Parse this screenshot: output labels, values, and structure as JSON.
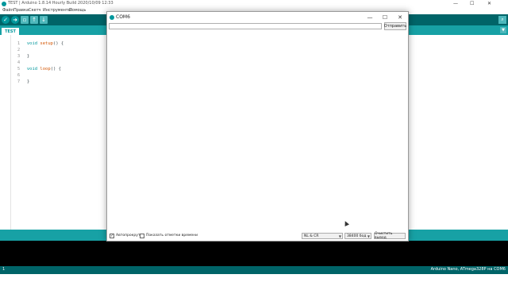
{
  "ide": {
    "title": "TEST | Arduino 1.8.14 Hourly Build 2020/10/09 12:33",
    "window_controls": {
      "minimize": "—",
      "maximize": "☐",
      "close": "✕"
    },
    "menu": [
      "Файл",
      "Правка",
      "Скетч",
      "Инструменты",
      "Помощь"
    ],
    "toolbar": {
      "verify_icon": "check-icon",
      "upload_icon": "arrow-right-icon",
      "new_icon": "new-file-icon",
      "open_icon": "open-icon",
      "save_icon": "save-icon",
      "serial_monitor_icon": "magnifier-icon"
    },
    "tab": {
      "label": "TEST"
    },
    "code": {
      "lines": [
        {
          "num": "1",
          "text": "void setup() {"
        },
        {
          "num": "2",
          "text": ""
        },
        {
          "num": "3",
          "text": "}"
        },
        {
          "num": "4",
          "text": ""
        },
        {
          "num": "5",
          "text": "void loop() {"
        },
        {
          "num": "6",
          "text": ""
        },
        {
          "num": "7",
          "text": "}"
        }
      ]
    },
    "status": {
      "line": "1",
      "board": "Arduino Nano, ATmega328P на COM6"
    },
    "colors": {
      "teal_dark": "#006468",
      "teal": "#17a1a5",
      "accent": "#00979c"
    }
  },
  "serial_monitor": {
    "title": "COM6",
    "window_controls": {
      "minimize": "—",
      "maximize": "☐",
      "close": "✕"
    },
    "send_input": {
      "value": "",
      "placeholder": ""
    },
    "send_button": "Отправить",
    "autoscroll": {
      "label": "Автопрокрутка",
      "checked": true
    },
    "timestamps": {
      "label": "Показать отметки времени",
      "checked": false
    },
    "line_ending": "NL & CR",
    "baud_rate": "38400 бод",
    "clear_button": "Очистить вывод"
  }
}
